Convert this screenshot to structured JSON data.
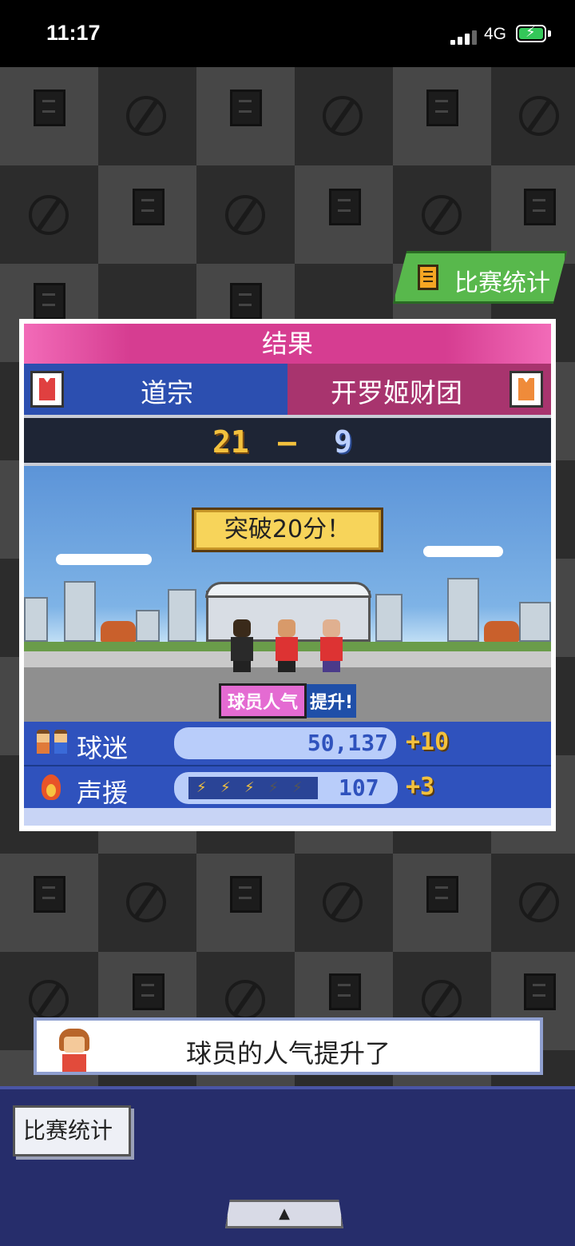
{
  "status_bar": {
    "time": "11:17",
    "network": "4G"
  },
  "top_button": {
    "label": "比赛统计",
    "icon": "document-icon"
  },
  "result": {
    "title": "结果",
    "home_team": "道宗",
    "away_team": "开罗姬财团",
    "home_score": "21",
    "separator": "–",
    "away_score": "9",
    "banner": "突破20分！",
    "popup_label": "球员人气",
    "popup_suffix": "提升!",
    "fans": {
      "label": "球迷",
      "value": "50,137",
      "delta": "+10"
    },
    "cheer": {
      "label": "声援",
      "value": "107",
      "delta": "+3",
      "level": 3,
      "level_max": 5
    }
  },
  "message": {
    "text": "球员的人气提升了"
  },
  "bottom": {
    "stats_label": "比赛统计",
    "expand_icon": "▲"
  },
  "colors": {
    "home": "#2c4fb0",
    "away": "#a8346e",
    "header": "#d63d91",
    "accent": "#f3c13d"
  }
}
